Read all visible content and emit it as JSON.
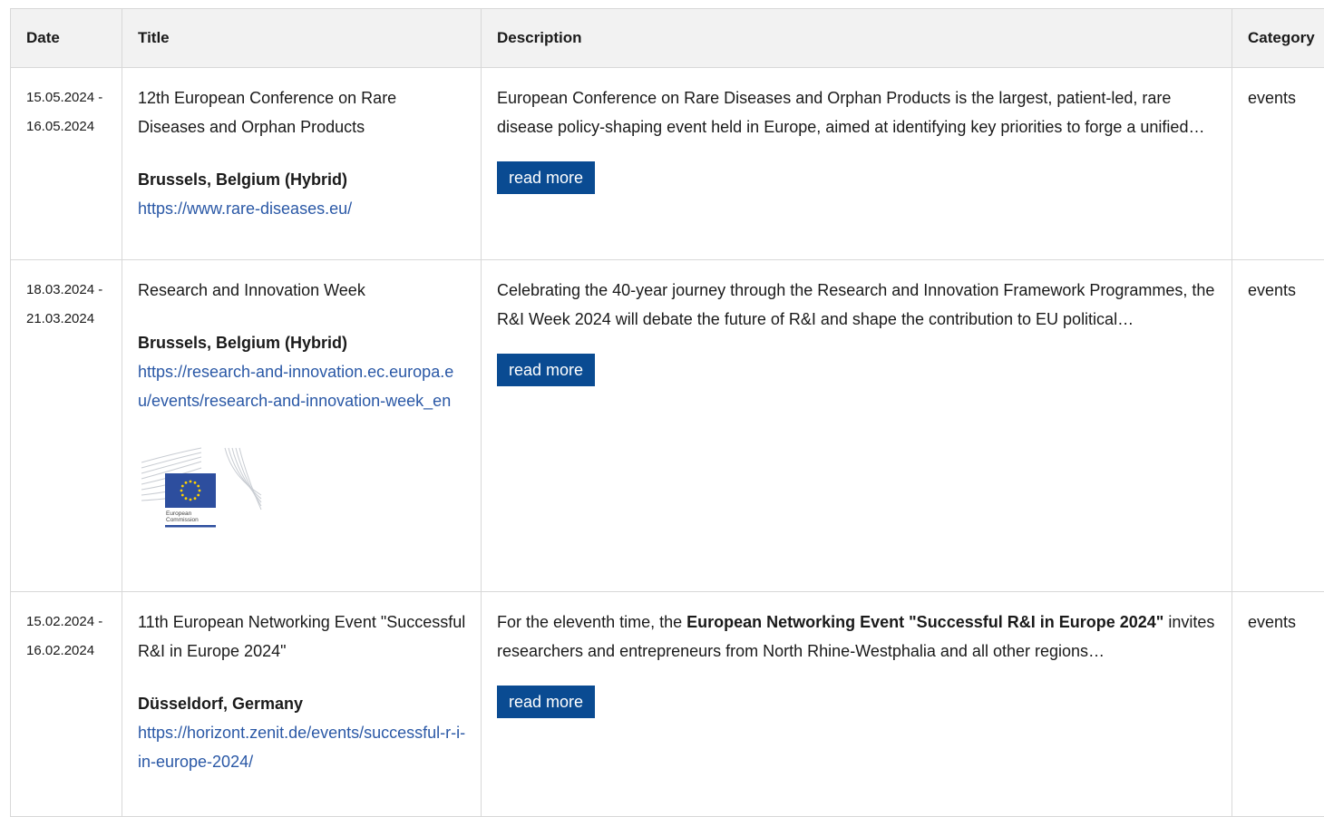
{
  "table": {
    "headers": {
      "date": "Date",
      "title": "Title",
      "description": "Description",
      "category": "Category"
    },
    "rows": [
      {
        "date_start": "15.05.2024 -",
        "date_end": "16.05.2024",
        "title": "12th European Conference on Rare Diseases and Orphan Products",
        "location": "Brussels, Belgium (Hybrid)",
        "url": "https://www.rare-diseases.eu/",
        "description": "European Conference on Rare Diseases and Orphan Products is the largest, patient-led, rare disease policy-shaping event held in Europe, aimed at identifying key priorities to forge a unified…",
        "button": "read more",
        "category": "events"
      },
      {
        "date_start": "18.03.2024 -",
        "date_end": "21.03.2024",
        "title": "Research and Innovation Week",
        "location": "Brussels, Belgium (Hybrid)",
        "url": "https://research-and-innovation.ec.europa.eu/events/research-and-innovation-week_en",
        "logo_text_line1": "European",
        "logo_text_line2": "Commission",
        "description": "Celebrating the 40-year journey through the Research and Innovation Framework Programmes, the R&I Week 2024 will debate the future of R&I and shape the contribution to EU political…",
        "button": "read more",
        "category": "events"
      },
      {
        "date_start": "15.02.2024 -",
        "date_end": "16.02.2024",
        "title": "11th European Networking Event \"Successful R&I in Europe 2024\"",
        "location": "Düsseldorf, Germany",
        "url": "https://horizont.zenit.de/events/successful-r-i-in-europe-2024/",
        "description_prefix": "For the eleventh time, the ",
        "description_bold": "European Networking Event \"Successful R&I in Europe 2024\"",
        "description_suffix": " invites researchers and entrepreneurs from North Rhine-Westphalia and all other regions…",
        "button": "read more",
        "category": "events"
      }
    ]
  },
  "colors": {
    "header_bg": "#f2f2f2",
    "link": "#2a58a6",
    "button_bg": "#0a4b92",
    "border": "#d8d8d8",
    "eu_blue": "#2d4e9e",
    "eu_yellow": "#ffd200"
  }
}
